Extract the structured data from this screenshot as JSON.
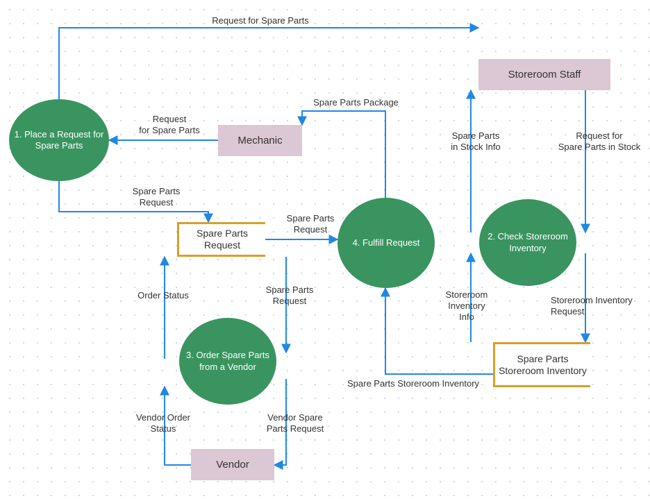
{
  "processes": {
    "p1": "1. Place a Request for Spare Parts",
    "p2": "2. Check Storeroom Inventory",
    "p3": "3. Order Spare Parts from a Vendor",
    "p4": "4. Fulfill Request"
  },
  "entities": {
    "mechanic": "Mechanic",
    "vendor": "Vendor",
    "storeroom_staff": "Storeroom Staff"
  },
  "stores": {
    "spare_parts_request": "Spare Parts Request",
    "spare_parts_storeroom_inventory": "Spare Parts Storeroom Inventory"
  },
  "flows": {
    "f_top": "Request for Spare Parts",
    "f_mech_p1_a": "Request",
    "f_mech_p1_b": "for Spare Parts",
    "f_p4_mech": "Spare Parts Package",
    "f_p1_store_a": "Spare Parts",
    "f_p1_store_b": "Request",
    "f_store_p4_a": "Spare Parts",
    "f_store_p4_b": "Request",
    "f_store_p3_a": "Spare Parts",
    "f_store_p3_b": "Request",
    "f_p3_store": "Order Status",
    "f_p3_vend_a": "Vendor Spare",
    "f_p3_vend_b": "Parts Request",
    "f_vend_p3_a": "Vendor Order",
    "f_vend_p3_b": "Status",
    "f_staff_p2_a": "Request for",
    "f_staff_p2_b": "Spare Parts in Stock",
    "f_p2_staff_a": "Spare Parts",
    "f_p2_staff_b": "in Stock Info",
    "f_p2_inv_a": "Storeroom Inventory",
    "f_p2_inv_b": "Request",
    "f_inv_p2_a": "Storeroom",
    "f_inv_p2_b": "Inventory",
    "f_inv_p2_c": "Info",
    "f_inv_p4": "Spare Parts Storeroom Inventory"
  },
  "colors": {
    "process": "#3a9460",
    "entity": "#dcc7d4",
    "store": "#d6a029",
    "arrow": "#1f87e6"
  }
}
